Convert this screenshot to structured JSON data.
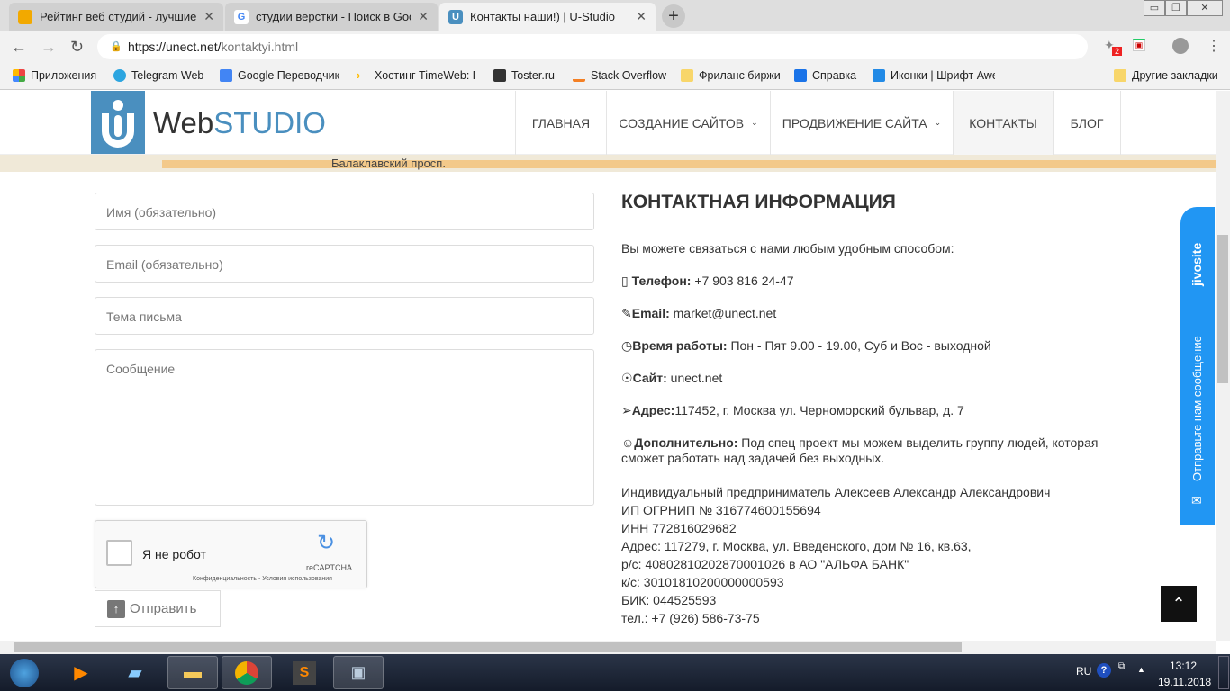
{
  "browser": {
    "tabs": [
      {
        "title": "Рейтинг веб студий - лучшие веб",
        "icon": "ratingruneta-icon"
      },
      {
        "title": "студии верстки - Поиск в Google",
        "icon": "google-icon"
      },
      {
        "title": "Контакты наши!) | U-Studio",
        "icon": "ustudio-icon",
        "active": true
      }
    ],
    "url_host": "https://unect.net/",
    "url_path": "kontaktyi.html",
    "extension_badge": "2",
    "bookmarks": [
      "Приложения",
      "Telegram Web",
      "Google Переводчик",
      "Хостинг TimeWeb: П",
      "Toster.ru",
      "Stack Overflow",
      "Фриланс биржи",
      "Справка",
      "Иконки | Шрифт Awe"
    ],
    "other_bookmarks": "Другие закладки"
  },
  "site": {
    "logo_web": "Web",
    "logo_studio": "STUDIO",
    "menu": [
      {
        "label": "ГЛАВНАЯ"
      },
      {
        "label": "СОЗДАНИЕ САЙТОВ",
        "dropdown": true
      },
      {
        "label": "ПРОДВИЖЕНИЕ САЙТА",
        "dropdown": true
      },
      {
        "label": "КОНТАКТЫ",
        "active": true
      },
      {
        "label": "БЛОГ"
      }
    ],
    "map_label": "Балаклавский просп.",
    "form": {
      "name_ph": "Имя (обязательно)",
      "email_ph": "Email (обязательно)",
      "subject_ph": "Тема письма",
      "message_ph": "Сообщение",
      "captcha_label": "Я не робот",
      "captcha_brand": "reCAPTCHA",
      "captcha_links": "Конфиденциальность - Условия использования",
      "submit": "Отправить"
    },
    "info": {
      "title": "КОНТАКТНАЯ ИНФОРМАЦИЯ",
      "intro": "Вы можете связаться с нами любым удобным способом:",
      "items": [
        {
          "icon": "phone-icon",
          "label": "Телефон:",
          "value": " +7 903 816 24-47"
        },
        {
          "icon": "pencil-icon",
          "label": "Email:",
          "value": " market@unect.net"
        },
        {
          "icon": "clock-icon",
          "label": "Время работы:",
          "value": " Пон - Пят 9.00 - 19.00, Суб и Вос - выходной"
        },
        {
          "icon": "globe-icon",
          "label": "Сайт:",
          "value": " unect.net"
        },
        {
          "icon": "location-arrow-icon",
          "label": "Адрес:",
          "value": "117452, г. Москва ул. Черноморский бульвар, д. 7"
        },
        {
          "icon": "users-icon",
          "label": "Дополнительно:",
          "value": " Под спец проект мы можем выделить группу людей, которая сможет работать над задачей без выходных."
        }
      ],
      "requisites": [
        "Индивидуальный предприниматель Алексеев Александр Александрович",
        "ИП ОГРНИП № 316774600155694",
        "ИНН 772816029682",
        "Адрес: 117279, г. Москва, ул. Введенского, дом № 16, кв.63,",
        "р/с: 40802810202870001026 в АО \"АЛЬФА БАНК\"",
        "к/с: 30101810200000000593",
        "БИК: 044525593",
        "тел.: +7 (926) 586-73-75"
      ]
    },
    "jivo": {
      "brand": "jivosite",
      "cta": "Отправьте нам сообщение"
    }
  },
  "taskbar": {
    "lang": "RU",
    "time": "13:12",
    "date": "19.11.2018"
  },
  "colors": {
    "brand": "#4a8fbf",
    "jivo": "#2196f3"
  }
}
